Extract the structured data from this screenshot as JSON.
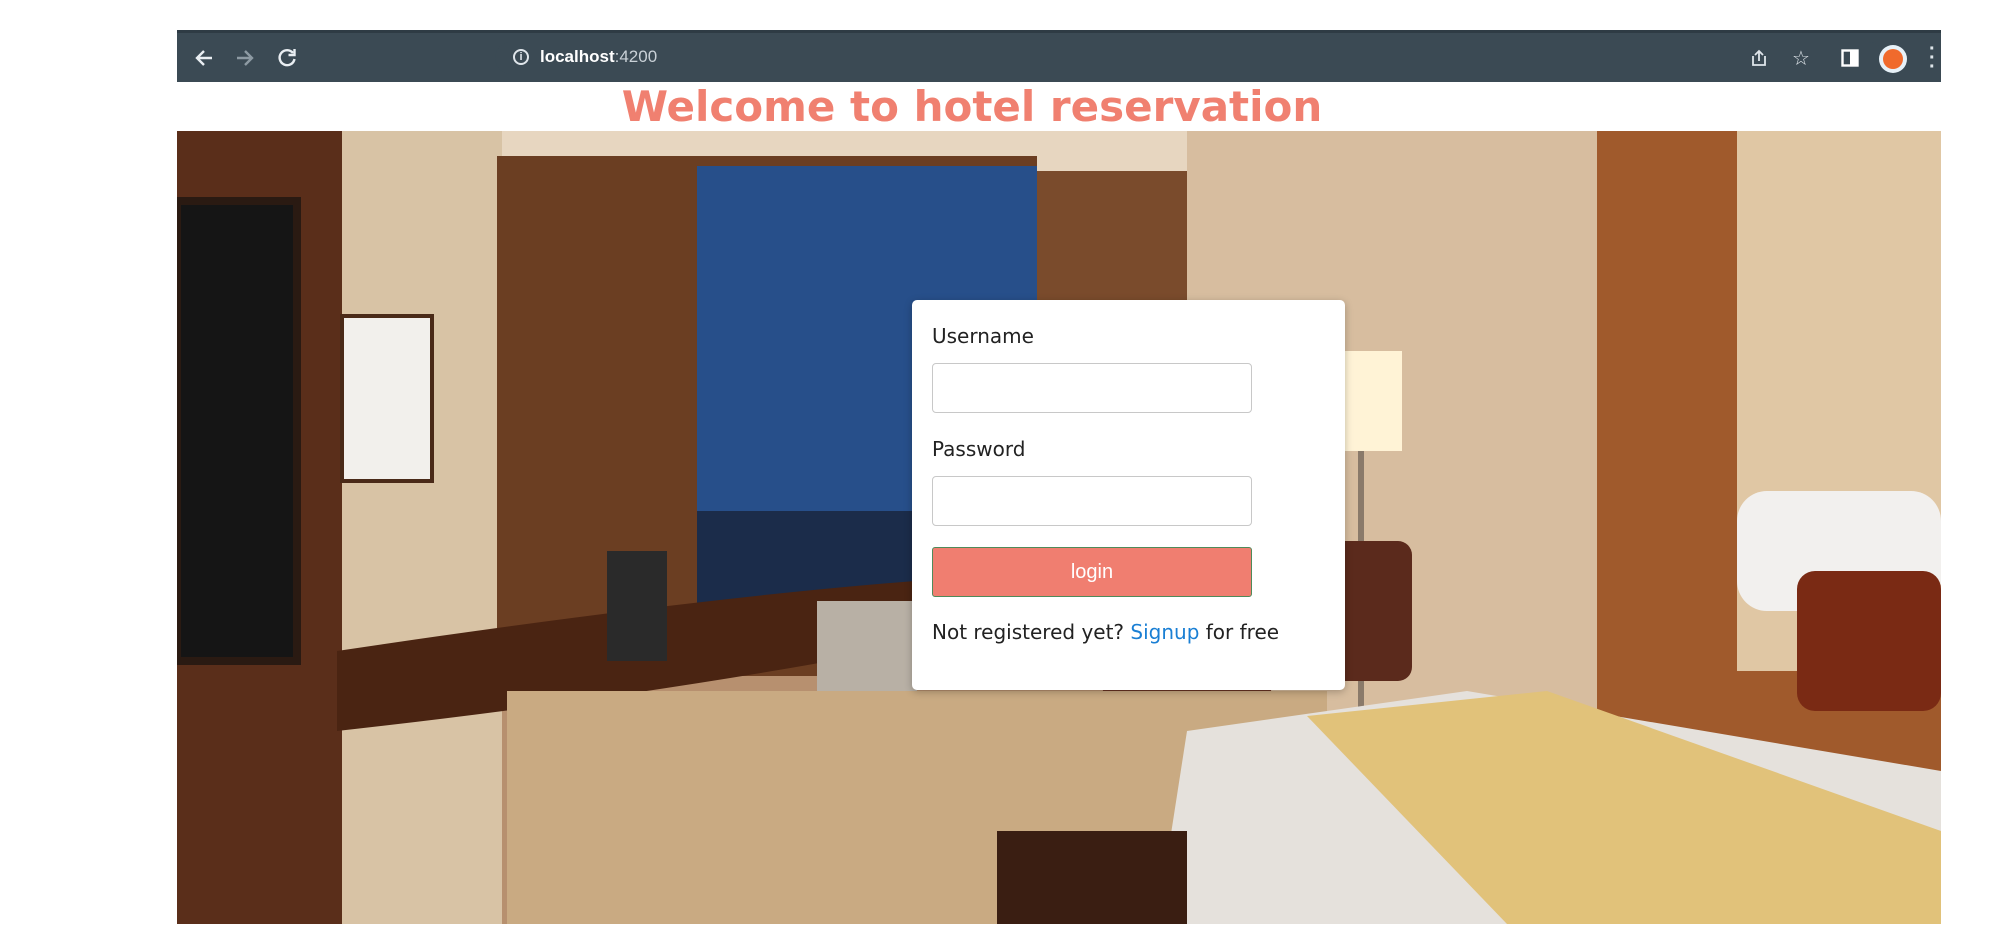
{
  "browser": {
    "url_host": "localhost",
    "url_port": ":4200",
    "icons": [
      "back-arrow-icon",
      "forward-arrow-icon",
      "reload-icon",
      "info-icon",
      "share-icon",
      "star-icon",
      "side-panel-icon",
      "avatar",
      "menu-icon"
    ]
  },
  "page": {
    "title": "Welcome to hotel reservation"
  },
  "login_form": {
    "username_label": "Username",
    "username_value": "",
    "password_label": "Password",
    "password_value": "",
    "login_button": "login",
    "signup_prefix": "Not registered yet? ",
    "signup_link": "Signup",
    "signup_suffix": " for free"
  },
  "colors": {
    "accent": "#f07e70",
    "title": "#f08070",
    "link": "#1a7fd4",
    "browser_bar": "#3b4a54"
  }
}
